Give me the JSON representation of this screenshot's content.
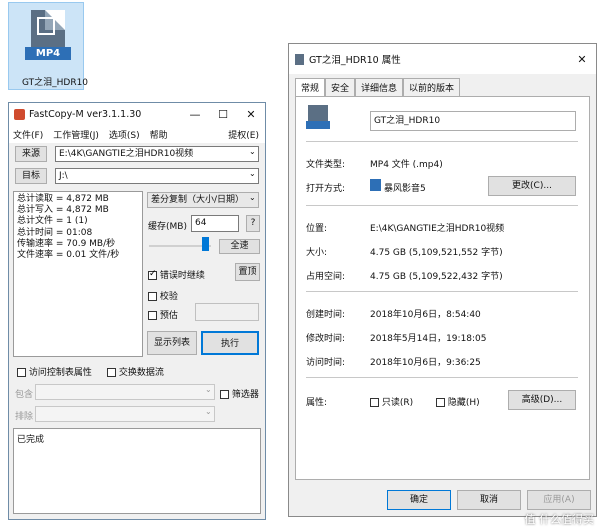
{
  "desktop_icon": {
    "badge": "MP4",
    "label": "GT之泪_HDR10"
  },
  "fastcopy": {
    "title": "FastCopy-M ver3.1.1.30",
    "controls": {
      "minimize": "—",
      "maximize": "☐",
      "close": "✕"
    },
    "menu": [
      "文件(F)",
      "工作管理(J)",
      "选项(S)",
      "帮助"
    ],
    "menu_right": "提权(E)",
    "source_button": "来源",
    "source_path": "E:\\4K\\GANGTIE之泪HDR10视频",
    "target_button": "目标",
    "target_path": "J:\\",
    "stats": [
      "总计读取 = 4,872 MB",
      "总计写入 = 4,872 MB",
      "总计文件 = 1 (1)",
      "总计时间 = 01:08",
      "传输速率 = 70.9 MB/秒",
      "文件速率 = 0.01 文件/秒"
    ],
    "mode": "差分复制（大小/日期）",
    "buffer_label": "缓存(MB)",
    "buffer_value": "64",
    "help": "?",
    "full_speed": "全速",
    "continue_on_error": "错误时继续",
    "top_button": "置顶",
    "verify": "校验",
    "estimate": "预估",
    "list_button": "显示列表",
    "execute_button": "执行",
    "acl": "访问控制表属性",
    "alt_stream": "交换数据流",
    "include_label": "包含",
    "exclude_label": "排除",
    "filter": "筛选器",
    "status": "已完成"
  },
  "props": {
    "title": "GT之泪_HDR10 属性",
    "close": "✕",
    "tabs": [
      "常规",
      "安全",
      "详细信息",
      "以前的版本"
    ],
    "filename": "GT之泪_HDR10",
    "rows": {
      "type_label": "文件类型:",
      "type_value": "MP4 文件 (.mp4)",
      "open_label": "打开方式:",
      "open_value": "暴风影音5",
      "change_button": "更改(C)...",
      "location_label": "位置:",
      "location_value": "E:\\4K\\GANGTIE之泪HDR10视频",
      "size_label": "大小:",
      "size_value": "4.75 GB (5,109,521,552 字节)",
      "disk_label": "占用空间:",
      "disk_value": "4.75 GB (5,109,522,432 字节)",
      "created_label": "创建时间:",
      "created_value": "2018年10月6日，8:54:40",
      "modified_label": "修改时间:",
      "modified_value": "2018年5月14日，19:18:05",
      "accessed_label": "访问时间:",
      "accessed_value": "2018年10月6日，9:36:25",
      "attr_label": "属性:",
      "readonly": "只读(R)",
      "hidden": "隐藏(H)",
      "advanced_button": "高级(D)..."
    },
    "ok_button": "确定",
    "cancel_button": "取消",
    "apply_button": "应用(A)"
  },
  "watermark": "值 什么值得买"
}
